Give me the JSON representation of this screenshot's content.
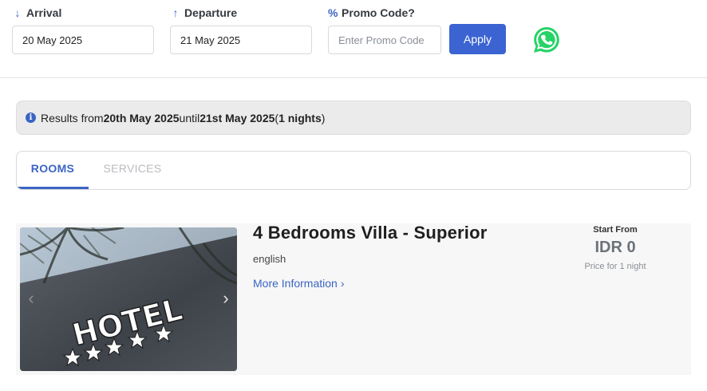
{
  "booking": {
    "arrival_label": "Arrival",
    "arrival_value": "20 May 2025",
    "departure_label": "Departure",
    "departure_value": "21 May 2025",
    "promo_label": "Promo Code?",
    "promo_placeholder": "Enter Promo Code",
    "apply_label": "Apply"
  },
  "results": {
    "prefix": "Results from ",
    "from_date": "20th May 2025",
    "until": " until ",
    "to_date": "21st May 2025",
    "open": " (",
    "nights": "1 nights",
    "close": ")"
  },
  "tabs": [
    {
      "label": "ROOMS"
    },
    {
      "label": "SERVICES"
    }
  ],
  "room": {
    "title": "4 Bedrooms Villa - Superior",
    "language": "english",
    "more_info": "More Information",
    "start_from": "Start From",
    "price": "IDR 0",
    "price_note": "Price for 1 night",
    "photo_sign": "HOTEL"
  },
  "colors": {
    "accent": "#3b64c4",
    "apply_button": "#3b64d2",
    "whatsapp": "#25d366"
  }
}
